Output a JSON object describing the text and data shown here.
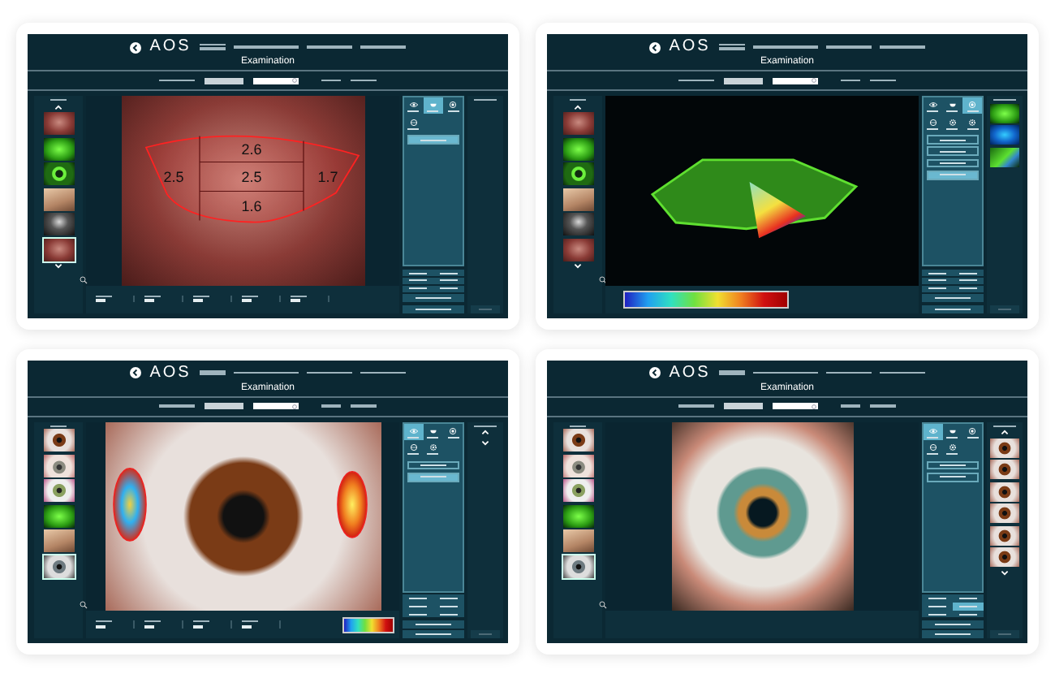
{
  "panels": [
    {
      "header": {
        "logo": "AOS",
        "title": "Examination"
      },
      "image_arrows": true,
      "saved_arrows": false,
      "thumbnails": [
        {
          "kind": "lid",
          "selected": false
        },
        {
          "kind": "green",
          "selected": false
        },
        {
          "kind": "ring",
          "selected": false
        },
        {
          "kind": "face",
          "selected": false
        },
        {
          "kind": "dark",
          "selected": false
        },
        {
          "kind": "lid",
          "selected": true
        }
      ],
      "main_image": {
        "kind": "lid",
        "overlay": {
          "kind": "grid",
          "values": [
            "2.6",
            "2.5",
            "2.5",
            "1.7",
            "1.6"
          ]
        }
      },
      "readings": {
        "kind": "stats5"
      },
      "tools": [
        {
          "selected": false
        },
        {
          "selected": true
        },
        {
          "selected": false
        },
        {
          "selected": false
        }
      ],
      "actions": [
        {
          "selected": true
        }
      ],
      "grid_buttons": [
        {
          "selected": false
        },
        {
          "selected": false
        },
        {
          "selected": false
        },
        {
          "selected": false
        },
        {
          "selected": false
        },
        {
          "selected": false
        }
      ],
      "report": {
        "disabled": true
      }
    },
    {
      "header": {
        "logo": "AOS",
        "title": "Examination"
      },
      "image_arrows": true,
      "saved_arrows": false,
      "thumbnails": [
        {
          "kind": "lid",
          "selected": false
        },
        {
          "kind": "green",
          "selected": false
        },
        {
          "kind": "ring",
          "selected": false
        },
        {
          "kind": "face",
          "selected": false
        },
        {
          "kind": "dark",
          "selected": false
        },
        {
          "kind": "lid",
          "selected": false
        }
      ],
      "main_image": {
        "kind": "thickness",
        "overlay": {
          "kind": "thickness-map"
        }
      },
      "readings": {
        "kind": "wide-scale"
      },
      "tools": [
        {
          "selected": false
        },
        {
          "selected": false
        },
        {
          "selected": true
        },
        {
          "selected": false
        },
        {
          "selected": false
        },
        {
          "selected": false
        }
      ],
      "actions": [
        {
          "selected": false
        },
        {
          "selected": false
        },
        {
          "selected": false
        },
        {
          "selected": true
        }
      ],
      "grid_buttons": [
        {
          "selected": false
        },
        {
          "selected": false
        },
        {
          "selected": false
        },
        {
          "selected": false
        },
        {
          "selected": false
        },
        {
          "selected": false
        }
      ],
      "report": {
        "disabled": true
      },
      "saved": [
        {
          "kind": "green"
        },
        {
          "kind": "blue-map"
        },
        {
          "kind": "green-map"
        }
      ]
    },
    {
      "header": {
        "logo": "AOS",
        "title": "Examination"
      },
      "image_arrows": false,
      "saved_arrows": true,
      "thumbnails": [
        {
          "kind": "brown-eye",
          "selected": false
        },
        {
          "kind": "red-eye",
          "selected": false
        },
        {
          "kind": "hazel-eye",
          "selected": false
        },
        {
          "kind": "green",
          "selected": false
        },
        {
          "kind": "face",
          "selected": false
        },
        {
          "kind": "grey-eye",
          "selected": true
        }
      ],
      "main_image": {
        "kind": "brown-eye",
        "overlay": {
          "kind": "heatmaps"
        }
      },
      "readings": {
        "kind": "stats4-scale"
      },
      "tools": [
        {
          "selected": true
        },
        {
          "selected": false
        },
        {
          "selected": false
        },
        {
          "selected": false
        },
        {
          "selected": false
        }
      ],
      "actions": [
        {
          "selected": false
        },
        {
          "selected": true
        }
      ],
      "grid_buttons": [
        {
          "selected": false
        },
        {
          "selected": false
        },
        {
          "selected": false
        },
        {
          "selected": false
        },
        {
          "selected": false
        },
        {
          "selected": false
        }
      ],
      "report": {
        "disabled": true
      }
    },
    {
      "header": {
        "logo": "AOS",
        "title": "Examination"
      },
      "image_arrows": false,
      "saved_arrows": true,
      "thumbnails": [
        {
          "kind": "brown-eye",
          "selected": false
        },
        {
          "kind": "red-eye",
          "selected": false
        },
        {
          "kind": "hazel-eye",
          "selected": false
        },
        {
          "kind": "green",
          "selected": false
        },
        {
          "kind": "face",
          "selected": false
        },
        {
          "kind": "grey-eye",
          "selected": true
        }
      ],
      "main_image": {
        "kind": "iris"
      },
      "tools": [
        {
          "selected": true
        },
        {
          "selected": false
        },
        {
          "selected": false
        },
        {
          "selected": false
        },
        {
          "selected": false
        }
      ],
      "actions": [
        {
          "selected": false
        },
        {
          "selected": false
        }
      ],
      "grid_buttons": [
        {
          "selected": false
        },
        {
          "selected": false
        },
        {
          "selected": false
        },
        {
          "selected": true
        },
        {
          "selected": false
        },
        {
          "selected": false
        }
      ],
      "report": {
        "disabled": true
      },
      "saved": [
        {
          "kind": "brown-eye"
        },
        {
          "kind": "brown-eye"
        },
        {
          "kind": "brown-eye"
        },
        {
          "kind": "brown-eye"
        },
        {
          "kind": "brown-eye"
        },
        {
          "kind": "brown-eye"
        }
      ]
    }
  ]
}
